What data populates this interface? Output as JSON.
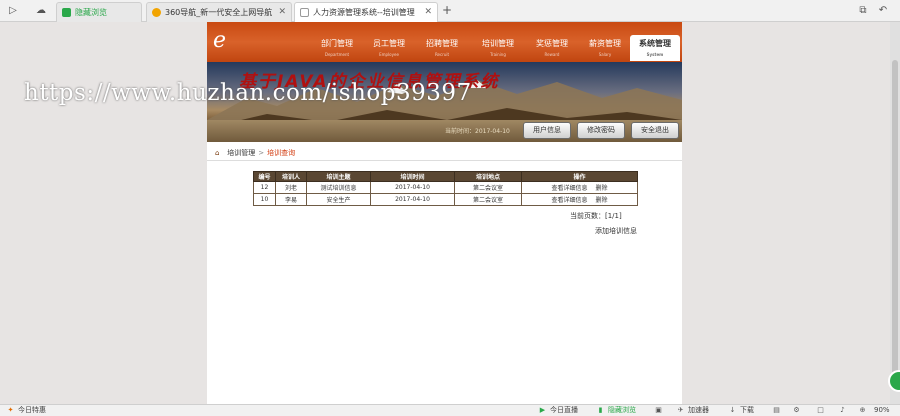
{
  "browser": {
    "tabs": [
      {
        "title": "隐藏浏览",
        "fav_color": "#2aa84a"
      },
      {
        "title": "360导航_新一代安全上网导航",
        "fav_color": "#f2a400"
      },
      {
        "title": "人力资源管理系统--培训管理",
        "fav_color": "#dcdcdc"
      }
    ],
    "status_left": "今日特惠",
    "status_items": [
      "今日直播",
      "隐藏浏览",
      "加速器",
      "下载"
    ],
    "zoom": "90%"
  },
  "app": {
    "nav": [
      {
        "label": "部门管理",
        "sub": "Department"
      },
      {
        "label": "员工管理",
        "sub": "Employee"
      },
      {
        "label": "招聘管理",
        "sub": "Recruit"
      },
      {
        "label": "培训管理",
        "sub": "Training"
      },
      {
        "label": "奖惩管理",
        "sub": "Reward"
      },
      {
        "label": "薪资管理",
        "sub": "Salary"
      },
      {
        "label": "系统管理",
        "sub": "System"
      }
    ],
    "banner_title": "基于JAVA的企业信息管理系统",
    "watermark": "https://www.huzhan.com/ishop39397",
    "date_line": "当前时间：2017-04-10",
    "toolbar_buttons": [
      "用户信息",
      "修改密码",
      "安全退出"
    ],
    "breadcrumb": {
      "parent": "培训管理",
      "current": "培训查询"
    },
    "table": {
      "headers": [
        "编号",
        "培训人",
        "培训主题",
        "培训时间",
        "培训地点",
        "操作"
      ],
      "rows": [
        {
          "id": "12",
          "person": "刘老",
          "topic": "测试培训信息",
          "time": "2017-04-10",
          "place": "第二会议室",
          "view": "查看详细信息",
          "del": "删除"
        },
        {
          "id": "10",
          "person": "李易",
          "topic": "安全生产",
          "time": "2017-04-10",
          "place": "第二会议室",
          "view": "查看详细信息",
          "del": "删除"
        }
      ]
    },
    "pager": "当前页数：[1/1]",
    "add_link": "添加培训信息"
  }
}
